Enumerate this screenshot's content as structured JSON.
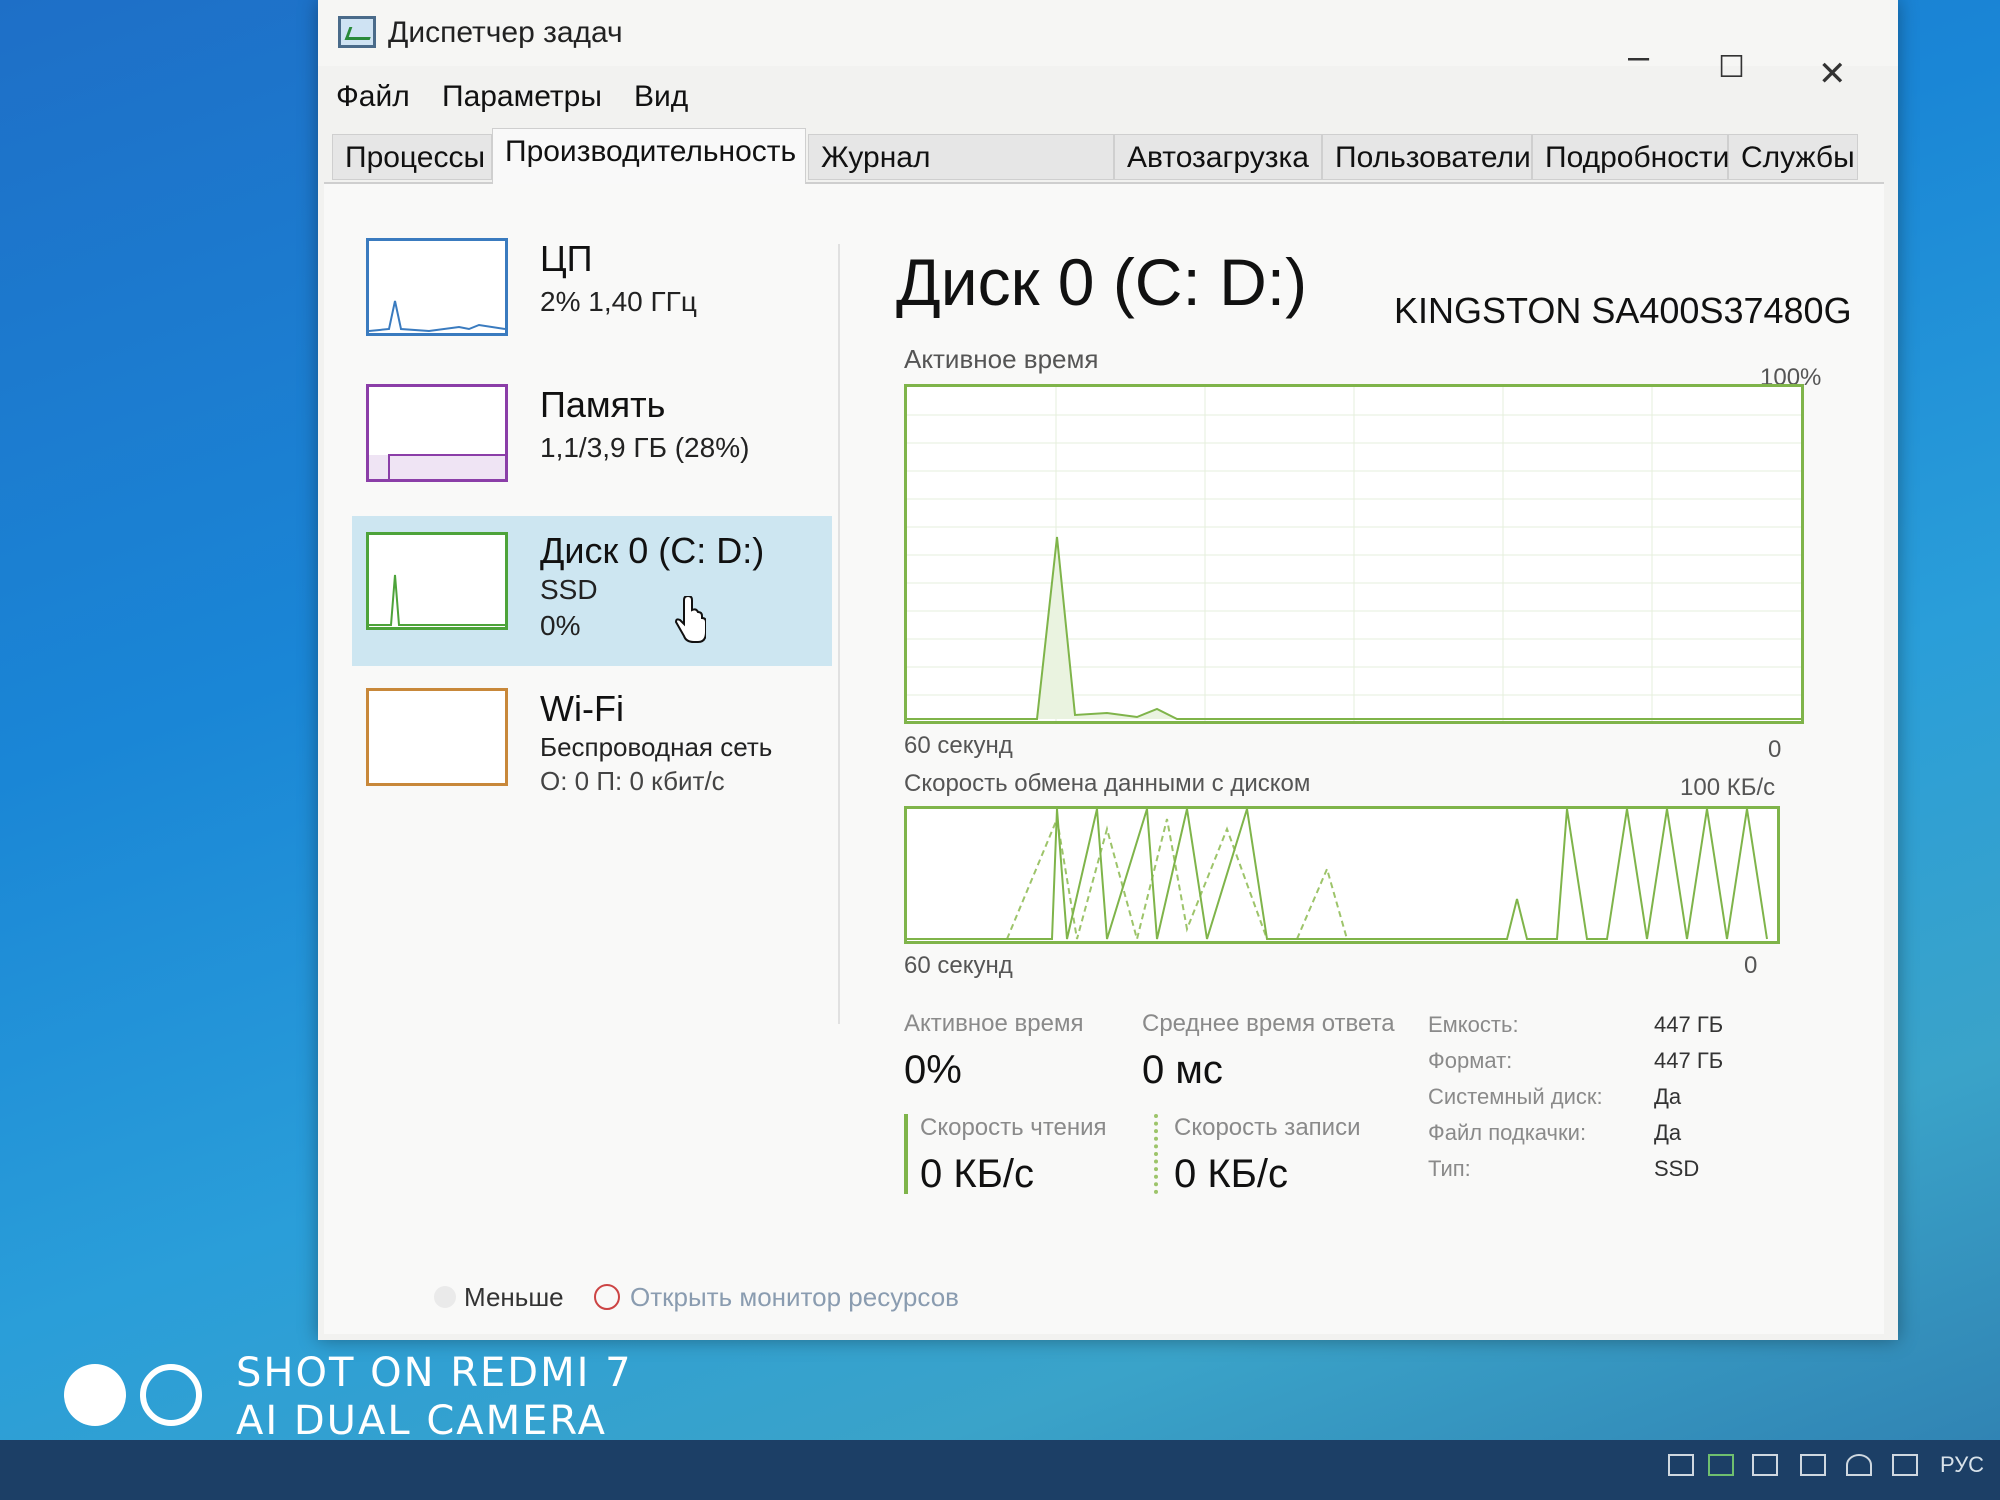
{
  "window": {
    "title": "Диспетчер задач",
    "controls": {
      "minimize": "–",
      "maximize": "☐",
      "close": "✕"
    }
  },
  "menu": [
    "Файл",
    "Параметры",
    "Вид"
  ],
  "tabs": [
    "Процессы",
    "Производительность",
    "Журнал приложений",
    "Автозагрузка",
    "Пользователи",
    "Подробности",
    "Службы"
  ],
  "active_tab": "Производительность",
  "sidebar": [
    {
      "name": "ЦП",
      "line1": "2% 1,40 ГГц",
      "line2": "",
      "color": "#3a7bbf"
    },
    {
      "name": "Память",
      "line1": "1,1/3,9 ГБ (28%)",
      "line2": "",
      "color": "#8b3ea8"
    },
    {
      "name": "Диск 0 (C: D:)",
      "line1": "SSD",
      "line2": "0%",
      "color": "#4da33a"
    },
    {
      "name": "Wi-Fi",
      "line1": "Беспроводная сеть",
      "line2": "О: 0 П: 0 кбит/с",
      "color": "#c8883a"
    }
  ],
  "main": {
    "title": "Диск 0 (C: D:)",
    "model": "KINGSTON SA400S37480G",
    "graph1": {
      "label": "Активное время",
      "max": "100%",
      "xleft": "60 секунд",
      "xright": "0"
    },
    "graph2": {
      "label": "Скорость обмена данными с диском",
      "max": "100 КБ/с",
      "xleft": "60 секунд",
      "xright": "0"
    }
  },
  "stats": {
    "active_time": {
      "label": "Активное время",
      "value": "0%"
    },
    "response": {
      "label": "Среднее время ответа",
      "value": "0 мс"
    },
    "read": {
      "label": "Скорость чтения",
      "value": "0 КБ/с"
    },
    "write": {
      "label": "Скорость записи",
      "value": "0 КБ/с"
    }
  },
  "info": [
    {
      "label": "Емкость:",
      "value": "447 ГБ"
    },
    {
      "label": "Формат:",
      "value": "447 ГБ"
    },
    {
      "label": "Системный диск:",
      "value": "Да"
    },
    {
      "label": "Файл подкачки:",
      "value": "Да"
    },
    {
      "label": "Тип:",
      "value": "SSD"
    }
  ],
  "footer": {
    "less": "Меньше",
    "monitor": "Открыть монитор ресурсов"
  },
  "watermark": {
    "line1": "SHOT ON REDMI 7",
    "line2": "AI DUAL CAMERA"
  },
  "taskbar": {
    "lang": "РУС"
  }
}
